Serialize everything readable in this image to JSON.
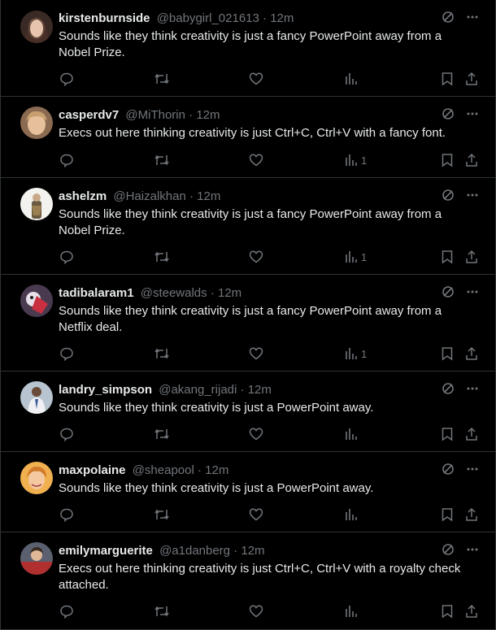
{
  "tweets": [
    {
      "name": "kirstenburnside",
      "handle": "@babygirl_021613",
      "sep": "·",
      "time": "12m",
      "text": "Sounds like they think creativity is just a fancy PowerPoint away from a Nobel Prize.",
      "views": "",
      "avatar_color": "#8a7060"
    },
    {
      "name": "casperdv7",
      "handle": "@MiThorin",
      "sep": "·",
      "time": "12m",
      "text": "Execs out here thinking creativity is just Ctrl+C, Ctrl+V with a fancy font.",
      "views": "1",
      "avatar_color": "#c9a07a"
    },
    {
      "name": "ashelzm",
      "handle": "@Haizalkhan",
      "sep": "·",
      "time": "12m",
      "text": "Sounds like they think creativity is just a fancy PowerPoint away from a Nobel Prize.",
      "views": "1",
      "avatar_color": "#e8e4dc"
    },
    {
      "name": "tadibalaram1",
      "handle": "@steewalds",
      "sep": "·",
      "time": "12m",
      "text": "Sounds like they think creativity is just a fancy PowerPoint away from a Netflix deal.",
      "views": "1",
      "avatar_color": "#6a5a70"
    },
    {
      "name": "landry_simpson",
      "handle": "@akang_rijadi",
      "sep": "·",
      "time": "12m",
      "text": "Sounds like they think creativity is just a PowerPoint away.",
      "views": "",
      "avatar_color": "#9aa8b8"
    },
    {
      "name": "maxpolaine",
      "handle": "@sheapool",
      "sep": "·",
      "time": "12m",
      "text": "Sounds like they think creativity is just a PowerPoint away.",
      "views": "",
      "avatar_color": "#e8a040"
    },
    {
      "name": "emilymarguerite",
      "handle": "@a1danberg",
      "sep": "·",
      "time": "12m",
      "text": "Execs out here thinking creativity is just Ctrl+C, Ctrl+V with a royalty check attached.",
      "views": "",
      "avatar_color": "#a03030"
    }
  ],
  "icons": {
    "reply": "reply-icon",
    "retweet": "retweet-icon",
    "like": "like-icon",
    "views": "views-icon",
    "bookmark": "bookmark-icon",
    "share": "share-icon",
    "grok": "grok-icon",
    "more": "more-icon"
  },
  "colors": {
    "background": "#000000",
    "text": "#e7e9ea",
    "muted": "#71767b",
    "border": "#2f3336"
  }
}
